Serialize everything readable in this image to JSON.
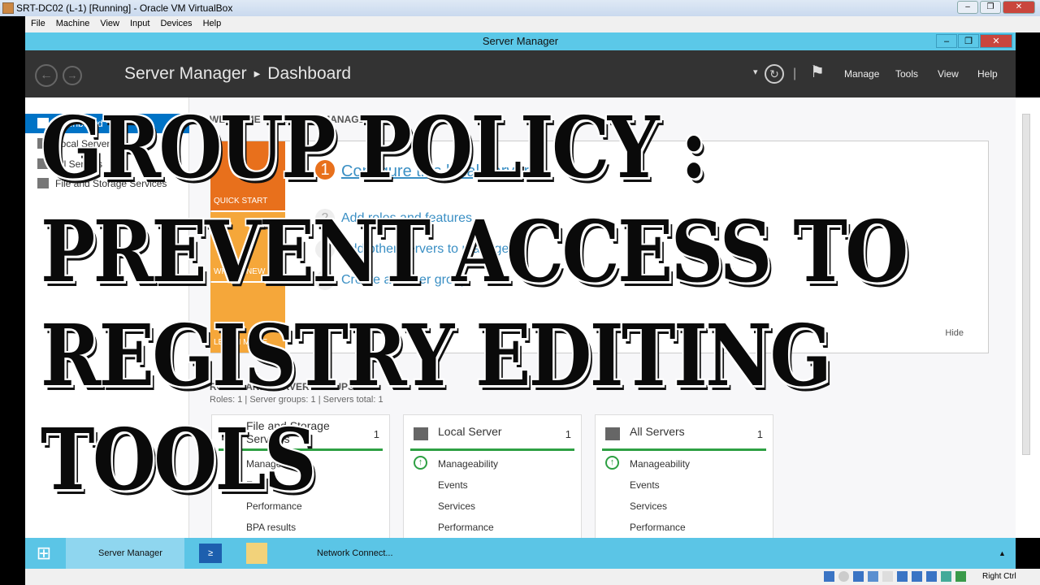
{
  "vbox": {
    "title": "SRT-DC02 (L-1) [Running] - Oracle VM VirtualBox",
    "menu": [
      "File",
      "Machine",
      "View",
      "Input",
      "Devices",
      "Help"
    ],
    "status_right": "Right Ctrl"
  },
  "window": {
    "title": "Server Manager"
  },
  "header": {
    "breadcrumb_root": "Server Manager",
    "breadcrumb_page": "Dashboard",
    "menu": [
      "Manage",
      "Tools",
      "View",
      "Help"
    ]
  },
  "sidebar": {
    "items": [
      {
        "label": "Dashboard",
        "selected": true
      },
      {
        "label": "Local Server"
      },
      {
        "label": "All Servers"
      },
      {
        "label": "File and Storage Services"
      }
    ]
  },
  "welcome": {
    "heading": "WELCOME TO SERVER MANAGER",
    "tiles": [
      "QUICK START",
      "WHAT'S NEW",
      "LEARN MORE"
    ],
    "steps": [
      {
        "n": "1",
        "label": "Configure this local server"
      },
      {
        "n": "2",
        "label": "Add roles and features"
      },
      {
        "n": "3",
        "label": "Add other servers to manage"
      },
      {
        "n": "4",
        "label": "Create a server group"
      }
    ],
    "hide": "Hide"
  },
  "roles": {
    "heading": "ROLES AND SERVER GROUPS",
    "summary": "Roles: 1  |  Server groups: 1  |  Servers total: 1",
    "cards": [
      {
        "title": "File and Storage Services",
        "count": "1",
        "rows": [
          "Manageability",
          "Events",
          "Performance",
          "BPA results"
        ]
      },
      {
        "title": "Local Server",
        "count": "1",
        "rows": [
          "Manageability",
          "Events",
          "Services",
          "Performance"
        ]
      },
      {
        "title": "All Servers",
        "count": "1",
        "rows": [
          "Manageability",
          "Events",
          "Services",
          "Performance"
        ]
      }
    ]
  },
  "taskbar": {
    "items": [
      "Server Manager",
      "Network Connect..."
    ]
  },
  "overlay": {
    "lines": [
      "GROUP POLICY :",
      "PREVENT ACCESS TO",
      "REGISTRY EDITING",
      "TOOLS"
    ]
  },
  "colors": {
    "accent": "#0073c6",
    "quick_start": "#e8701c",
    "whats_new": "#f5a73a",
    "header": "#333333",
    "taskbar": "#5bc5e6",
    "ok": "#2ea043"
  }
}
